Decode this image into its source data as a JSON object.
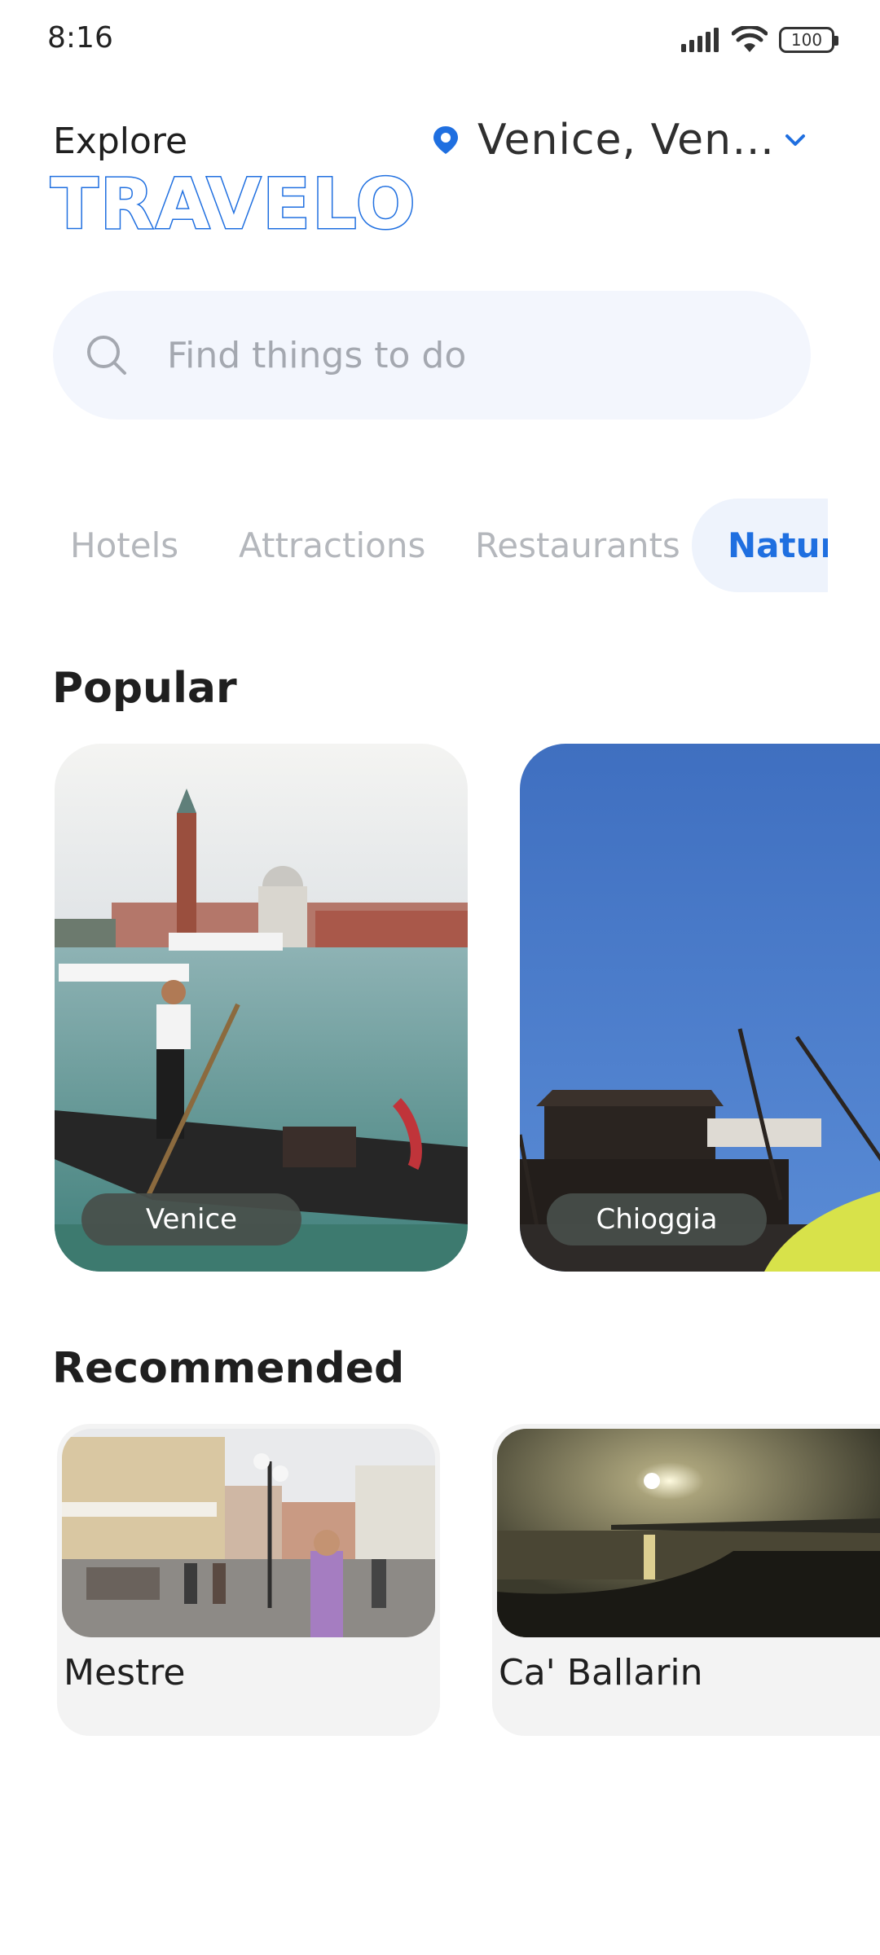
{
  "status_bar": {
    "time": "8:16",
    "battery": "100"
  },
  "header": {
    "explore_label": "Explore",
    "brand": "TRAVELO",
    "location": "Venice, Venet..."
  },
  "search": {
    "placeholder": "Find things to do"
  },
  "tabs": [
    {
      "label": "Hotels",
      "selected": false
    },
    {
      "label": "Attractions",
      "selected": false
    },
    {
      "label": "Restaurants",
      "selected": false
    },
    {
      "label": "Nature",
      "selected": true
    }
  ],
  "popular": {
    "title": "Popular",
    "cards": [
      {
        "label": "Venice"
      },
      {
        "label": "Chioggia"
      }
    ]
  },
  "recommended": {
    "title": "Recommended",
    "cards": [
      {
        "name": "Mestre"
      },
      {
        "name": "Ca' Ballarin"
      }
    ]
  },
  "colors": {
    "accent": "#1f6fe0",
    "search_bg": "#f3f6fd",
    "chip_bg": "#484e4a"
  },
  "icons": [
    "signal-icon",
    "wifi-icon",
    "battery-icon",
    "location-pin-icon",
    "chevron-down-icon",
    "search-icon"
  ]
}
